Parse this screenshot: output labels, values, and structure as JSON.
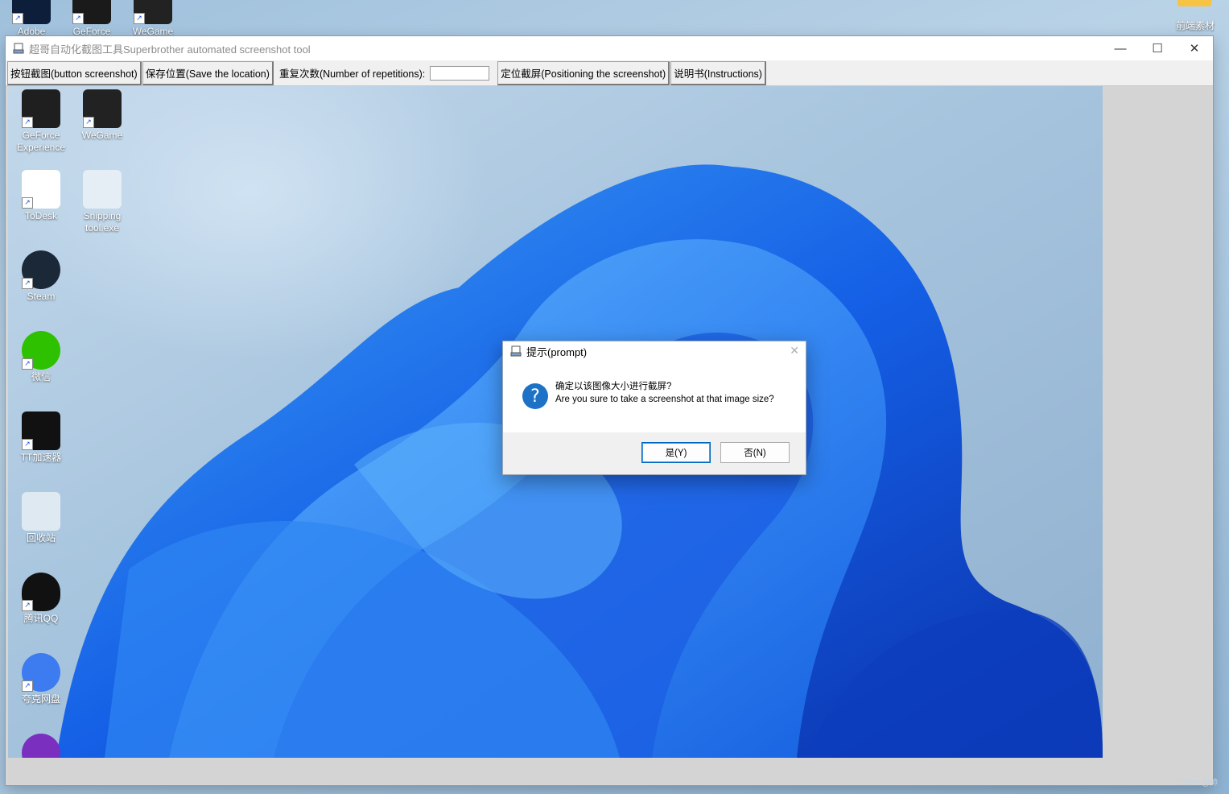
{
  "desktop_top": [
    {
      "label": "Adobe",
      "icon": "adobe-icon"
    },
    {
      "label": "GeForce",
      "icon": "geforce-icon"
    },
    {
      "label": "WeGame",
      "icon": "wegame-icon"
    }
  ],
  "desktop_folder": {
    "label": "前端素材",
    "icon": "folder-icon"
  },
  "window": {
    "title": "超哥自动化截图工具Superbrother automated screenshot tool",
    "minimize": "—",
    "maximize": "☐",
    "close": "✕"
  },
  "toolbar": {
    "button_screenshot": "按钮截图(button screenshot)",
    "save_location": "保存位置(Save the location)",
    "repetitions_label": "重复次数(Number of repetitions):",
    "repetitions_value": "",
    "positioning_screenshot": "定位截屏(Positioning the screenshot)",
    "instructions": "说明书(Instructions)"
  },
  "captured_icons": [
    {
      "label": "GeForce Experience",
      "icon": "geforce-icon",
      "color": "#2a2a2a"
    },
    {
      "label": "WeGame",
      "icon": "wegame-icon",
      "color": "#222"
    },
    {
      "label": "ToDesk",
      "icon": "todesk-icon",
      "color": "#ffffff"
    },
    {
      "label": "Snipping tool.exe",
      "icon": "printer-icon",
      "color": "#e6eef5"
    },
    {
      "label": "Steam",
      "icon": "steam-icon",
      "color": "#1b2838"
    },
    {
      "label": "微信",
      "icon": "wechat-icon",
      "color": "#2dc100"
    },
    {
      "label": "TT加速器",
      "icon": "tt-accelerator-icon",
      "color": "#111"
    },
    {
      "label": "回收站",
      "icon": "recycle-bin-icon",
      "color": "#dfe9f2"
    },
    {
      "label": "腾讯QQ",
      "icon": "qq-icon",
      "color": "#111"
    },
    {
      "label": "夸克网盘",
      "icon": "quark-cloud-icon",
      "color": "#3d7bf0"
    }
  ],
  "dialog": {
    "title": "提示(prompt)",
    "message_cn": "确定以该图像大小进行截屏?",
    "message_en": "Are you sure to take a screenshot at that image size?",
    "yes": "是(Y)",
    "no": "否(N)",
    "close": "✕"
  },
  "watermark": "CSDN @帅"
}
